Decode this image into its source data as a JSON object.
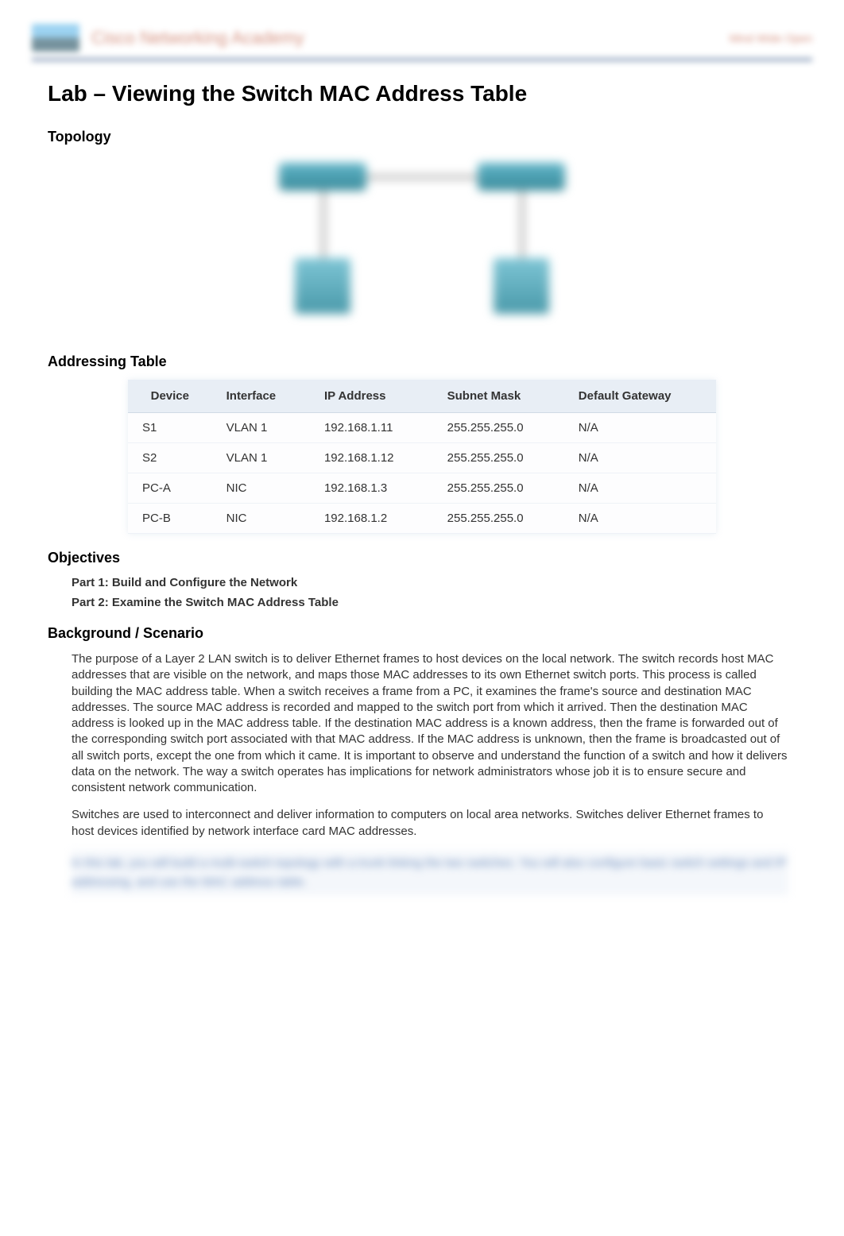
{
  "header": {
    "brand": "Cisco Networking Academy",
    "right": "Mind Wide Open"
  },
  "title": "Lab – Viewing the Switch MAC Address Table",
  "sections": {
    "topology": "Topology",
    "addressing": "Addressing Table",
    "objectives": "Objectives",
    "background": "Background / Scenario"
  },
  "addressing_table": {
    "headers": [
      "Device",
      "Interface",
      "IP Address",
      "Subnet Mask",
      "Default Gateway"
    ],
    "rows": [
      {
        "device": "S1",
        "interface": "VLAN 1",
        "ip": "192.168.1.11",
        "mask": "255.255.255.0",
        "gateway": "N/A"
      },
      {
        "device": "S2",
        "interface": "VLAN 1",
        "ip": "192.168.1.12",
        "mask": "255.255.255.0",
        "gateway": "N/A"
      },
      {
        "device": "PC-A",
        "interface": "NIC",
        "ip": "192.168.1.3",
        "mask": "255.255.255.0",
        "gateway": "N/A"
      },
      {
        "device": "PC-B",
        "interface": "NIC",
        "ip": "192.168.1.2",
        "mask": "255.255.255.0",
        "gateway": "N/A"
      }
    ]
  },
  "objectives": {
    "part1": "Part 1: Build and Configure the Network",
    "part2": "Part 2: Examine the Switch MAC Address Table"
  },
  "background": {
    "p1": "The purpose of a Layer 2 LAN switch is to deliver Ethernet frames to host devices on the local network. The switch records host MAC addresses that are visible on the network, and maps those MAC addresses to its own Ethernet switch ports. This process is called building the MAC address table. When a switch receives a frame from a PC, it examines the frame's source and destination MAC addresses. The source MAC address is recorded and mapped to the switch port from which it arrived. Then the destination MAC address is looked up in the MAC address table. If the destination MAC address is a known address, then the frame is forwarded out of the corresponding switch port associated with that MAC address. If the MAC address is unknown, then the frame is broadcasted out of all switch ports, except the one from which it came. It is important to observe and understand the function of a switch and how it delivers data on the network. The way a switch operates has implications for network administrators whose job it is to ensure secure and consistent network communication.",
    "p2": "Switches are used to interconnect and deliver information to computers on local area networks. Switches deliver Ethernet frames to host devices identified by network interface card MAC addresses.",
    "p3_blurred": "In this lab, you will build a multi-switch topology with a trunk linking the two switches. You will also configure basic switch settings and IP addressing, and use the MAC address table."
  }
}
